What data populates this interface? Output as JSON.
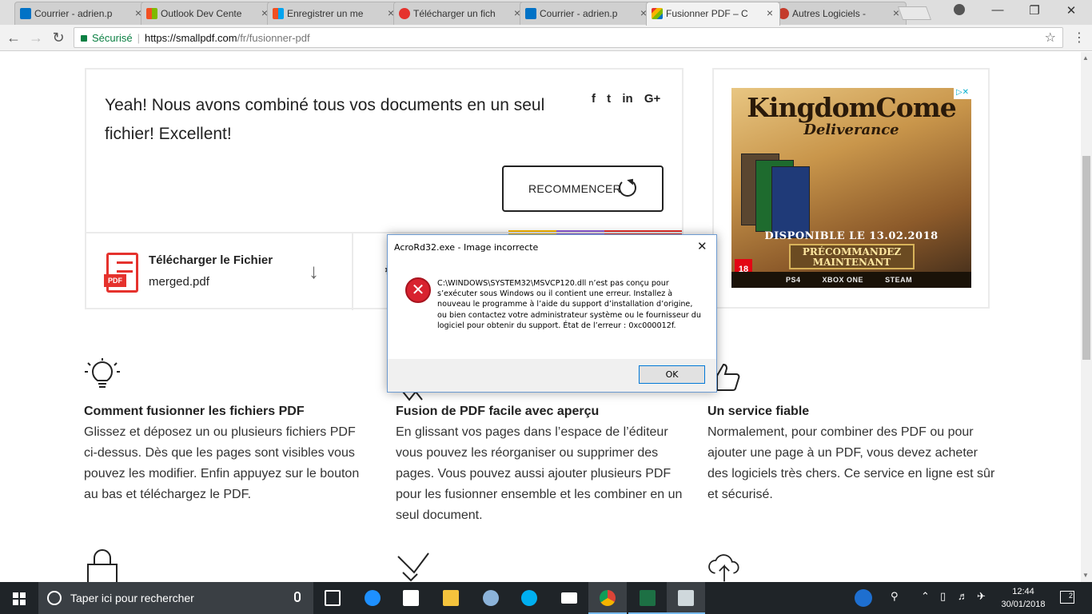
{
  "browser": {
    "tabs": [
      {
        "label": "Courrier - adrien.p",
        "color": "#0072c6"
      },
      {
        "label": "Outlook Dev Cente",
        "color": "#f25022"
      },
      {
        "label": "Enregistrer un me",
        "color": "#7fba00"
      },
      {
        "label": "Télécharger un fich",
        "color": "#e5322d"
      },
      {
        "label": "Courrier - adrien.p",
        "color": "#0072c6"
      },
      {
        "label": "Fusionner PDF – C",
        "color": "#e5322d"
      },
      {
        "label": "Autres Logiciels - ",
        "color": "#c43b2b"
      }
    ],
    "tab_close_glyph": "×",
    "secure_label": "Sécurisé",
    "url_host": "https://smallpdf.com",
    "url_path": "/fr/fusionner-pdf"
  },
  "main": {
    "success_message": "Yeah! Nous avons combiné tous vos documents en un seul fichier! Excellent!",
    "share_icons": [
      "facebook-icon",
      "twitter-icon",
      "linkedin-icon",
      "google-plus-icon"
    ],
    "share_glyphs": [
      "f",
      "t",
      "in",
      "G+"
    ],
    "restart_label": "RECOMMENCER",
    "download_title": "Télécharger le Fichier",
    "download_file": "merged.pdf",
    "pdf_tag": "PDF"
  },
  "ad": {
    "title": "KingdomCome",
    "subtitle": "Deliverance",
    "date": "DISPONIBLE LE 13.02.2018",
    "cta_line1": "PRÉCOMMANDEZ",
    "cta_line2": "MAINTENANT",
    "pegi": "18",
    "platforms": [
      "PS4",
      "XBOX ONE",
      "STEAM"
    ]
  },
  "features": [
    {
      "title": "Comment fusionner les fichiers PDF",
      "text": "Glissez et déposez un ou plusieurs fichiers PDF ci-dessus. Dès que les pages sont visibles vous pouvez les modifier. Enfin appuyez sur le bouton au bas et téléchargez le PDF."
    },
    {
      "title": "Fusion de PDF facile avec aperçu",
      "text": "En glissant vos pages dans l’espace de l’éditeur vous pouvez les réorganiser ou supprimer des pages. Vous pouvez aussi ajouter plusieurs PDF pour les fusionner ensemble et les combiner en un seul document."
    },
    {
      "title": "Un service fiable",
      "text": "Normalement, pour combiner des PDF ou pour ajouter une page à un PDF, vous devez acheter des logiciels très chers. Ce service en ligne est sûr et sécurisé."
    }
  ],
  "dialog": {
    "title": "AcroRd32.exe - Image incorrecte",
    "message": "C:\\WINDOWS\\SYSTEM32\\MSVCP120.dll n’est pas conçu pour s’exécuter sous Windows ou il contient une erreur. Installez à nouveau le programme à l’aide du support d’installation d’origine, ou bien contactez votre administrateur système ou le fournisseur du logiciel pour obtenir du support. État de l’erreur : 0xc000012f.",
    "ok_label": "OK"
  },
  "taskbar": {
    "search_placeholder": "Taper ici pour rechercher",
    "time": "12:44",
    "date": "30/01/2018",
    "notification_count": "2"
  },
  "colors": {
    "accent_red": "#e5322d",
    "secure_green": "#0b8043",
    "taskbar": "#1f2428"
  }
}
